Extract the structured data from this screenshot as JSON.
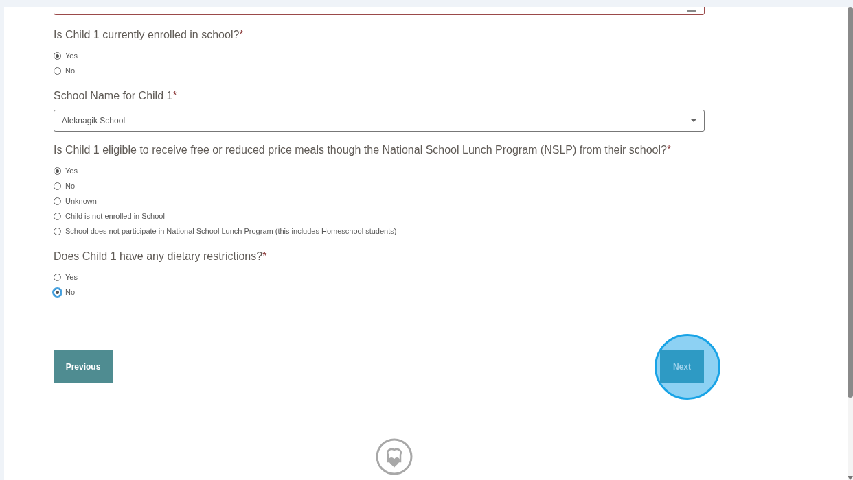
{
  "questions": [
    {
      "kind": "radio",
      "label": "Is Child 1 currently enrolled in school?",
      "mark": "*",
      "options": [
        {
          "label": "Yes",
          "selected": true,
          "focused": false
        },
        {
          "label": "No",
          "selected": false,
          "focused": false
        }
      ]
    },
    {
      "kind": "select",
      "label": "School Name for Child 1",
      "mark": "*",
      "value": "Aleknagik School"
    },
    {
      "kind": "radio",
      "label": "Is Child 1 eligible to receive free or reduced price meals though the National School Lunch Program (NSLP) from their school?",
      "mark": "*",
      "options": [
        {
          "label": "Yes",
          "selected": true,
          "focused": false
        },
        {
          "label": "No",
          "selected": false,
          "focused": false
        },
        {
          "label": "Unknown",
          "selected": false,
          "focused": false
        },
        {
          "label": "Child is not enrolled in School",
          "selected": false,
          "focused": false
        },
        {
          "label": "School does not participate in National School Lunch Program (this includes Homeschool students)",
          "selected": false,
          "focused": false
        }
      ]
    },
    {
      "kind": "radio",
      "label": "Does Child 1 have any dietary restrictions?",
      "mark": "*",
      "options": [
        {
          "label": "Yes",
          "selected": false,
          "focused": false
        },
        {
          "label": "No",
          "selected": true,
          "focused": true
        }
      ]
    }
  ],
  "buttons": {
    "previous": "Previous",
    "next": "Next",
    "next_highlighted": true
  }
}
